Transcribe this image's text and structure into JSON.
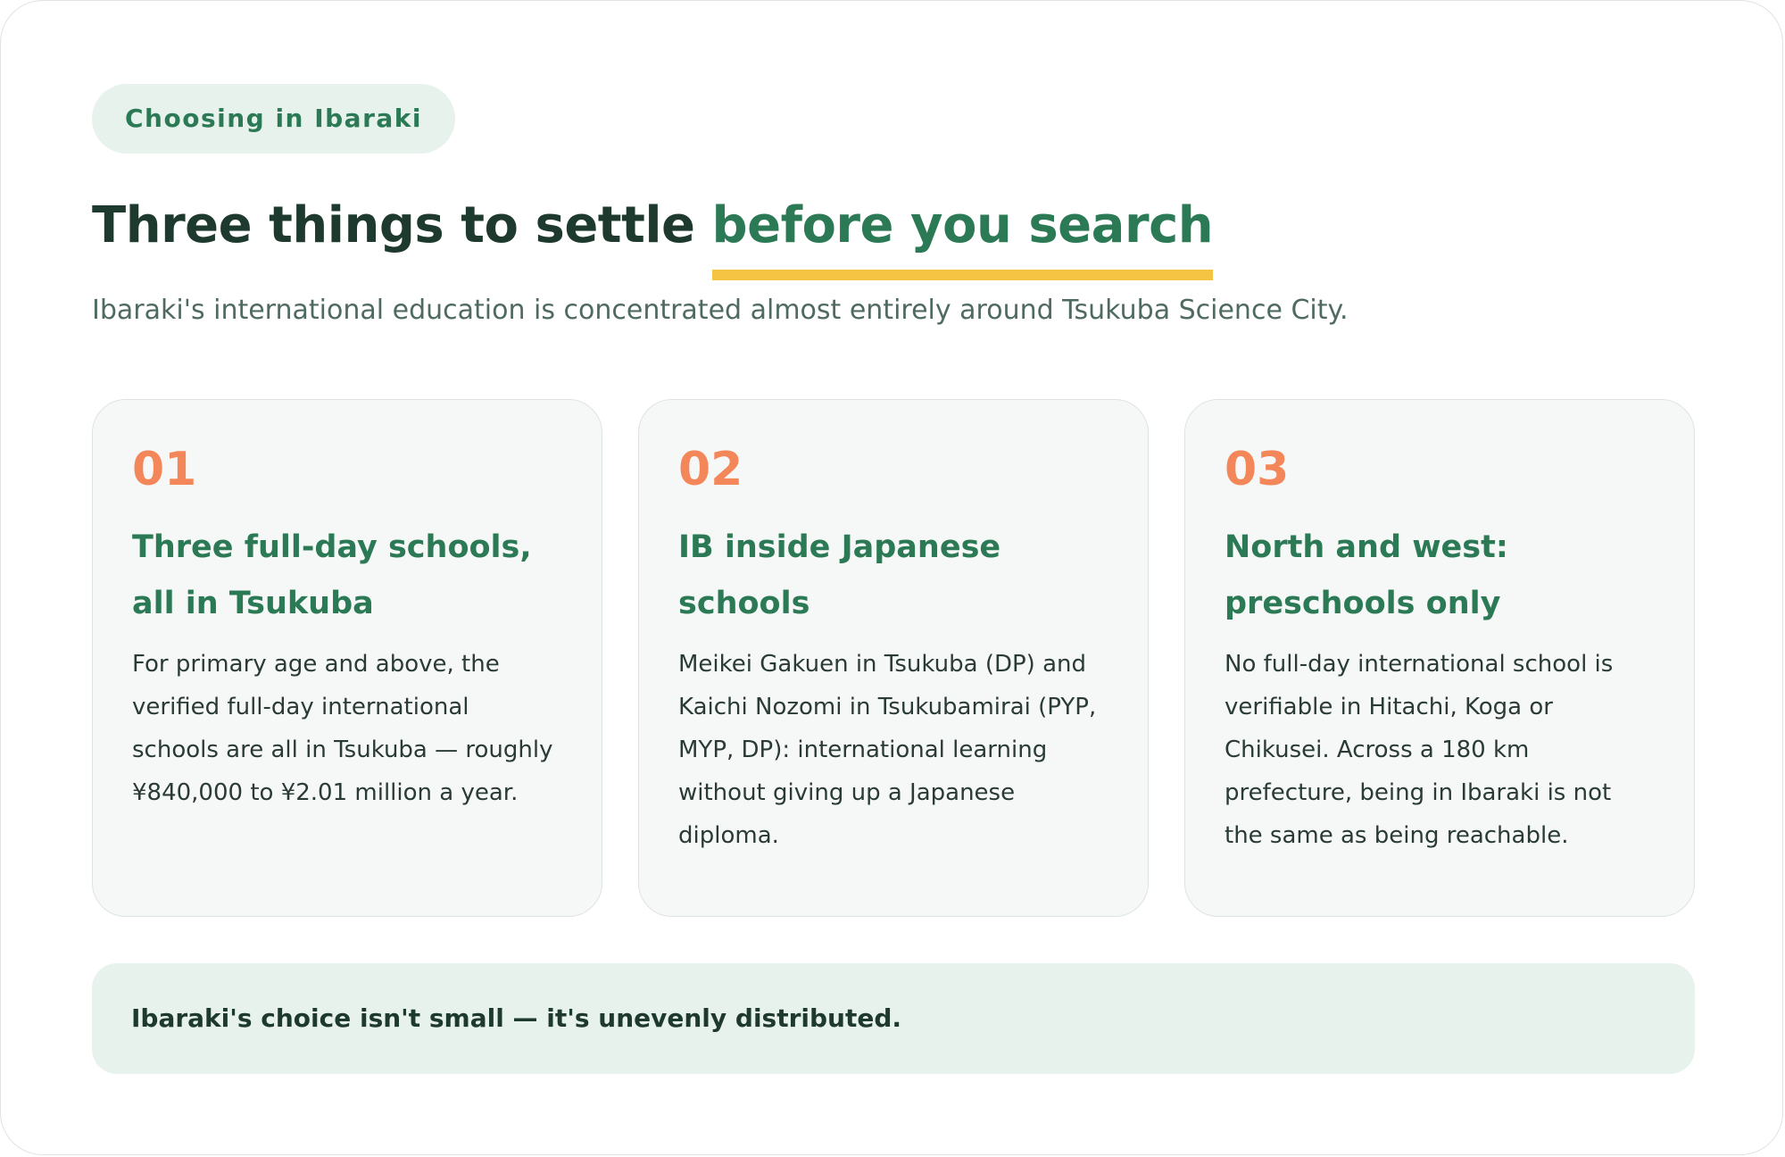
{
  "eyebrow": "Choosing in Ibaraki",
  "headline": {
    "lead": "Three things to settle ",
    "accent": "before you search"
  },
  "subtitle": "Ibaraki's international education is concentrated almost entirely around Tsukuba Science City.",
  "cards": [
    {
      "number": "01",
      "title": "Three full-day schools, all in Tsukuba",
      "body": "For primary age and above, the verified full-day international schools are all in Tsukuba — roughly ¥840,000 to ¥2.01 million a year."
    },
    {
      "number": "02",
      "title": "IB inside Japanese schools",
      "body": "Meikei Gakuen in Tsukuba (DP) and Kaichi Nozomi in Tsukubamirai (PYP, MYP, DP): international learning without giving up a Japanese diploma."
    },
    {
      "number": "03",
      "title": "North and west: preschools only",
      "body": "No full-day international school is verifiable in Hitachi, Koga or Chikusei. Across a 180 km prefecture, being in Ibaraki is not the same as being reachable."
    }
  ],
  "callout": "Ibaraki's choice isn't small — it's unevenly distributed.",
  "colors": {
    "accent_green": "#2b7a55",
    "number_orange": "#f4875a",
    "underline_yellow": "#f6c443",
    "pale_green": "#e8f2ec"
  }
}
